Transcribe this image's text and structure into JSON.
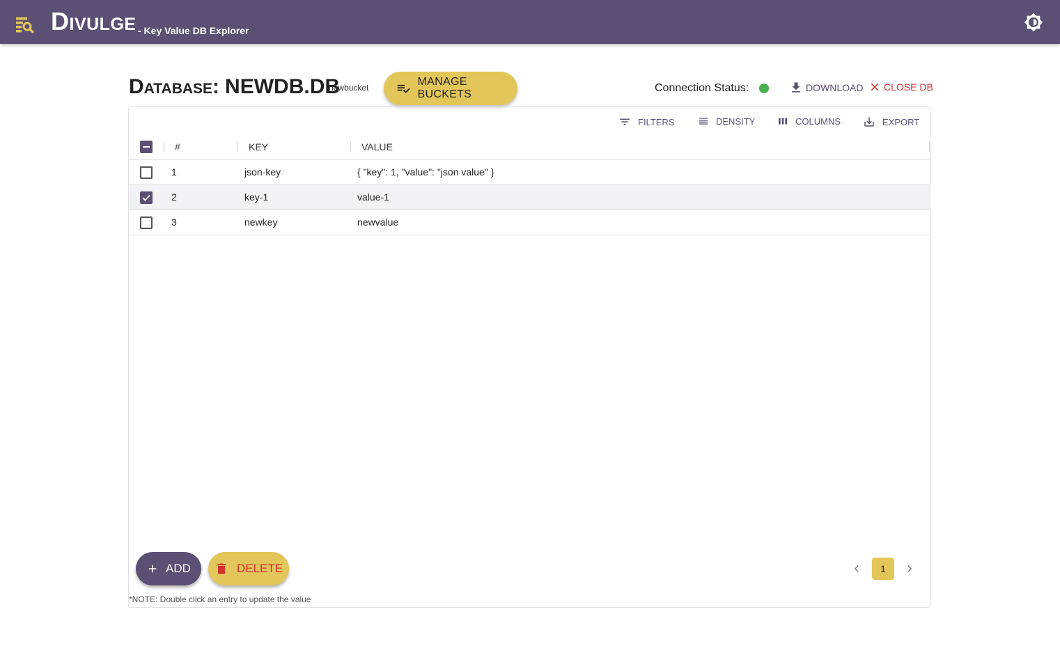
{
  "app": {
    "title": "Divulge",
    "subtitle": "- Key Value DB Explorer",
    "logo_icon": "db-search-icon",
    "theme_icon": "brightness-icon"
  },
  "database": {
    "label": "Database:",
    "name": "NEWDB.DB",
    "bucket": "newbucket"
  },
  "actions": {
    "manage_buckets": "MANAGE BUCKETS",
    "connection_status_label": "Connection Status:",
    "connection_status_color": "#4caf50",
    "download": "DOWNLOAD",
    "close_db": "CLOSE DB"
  },
  "toolbar": {
    "filters": "FILTERS",
    "density": "DENSITY",
    "columns": "COLUMNS",
    "export": "EXPORT"
  },
  "table": {
    "columns": [
      "#",
      "KEY",
      "VALUE"
    ],
    "rows": [
      {
        "num": "1",
        "key": "json-key",
        "value": "{ \"key\": 1, \"value\": \"json value\" }",
        "selected": false
      },
      {
        "num": "2",
        "key": "key-1",
        "value": "value-1",
        "selected": true
      },
      {
        "num": "3",
        "key": "newkey",
        "value": "newvalue",
        "selected": false
      }
    ]
  },
  "footer": {
    "add": "ADD",
    "delete": "DELETE",
    "note": "*NOTE: Double click an entry to update the value",
    "current_page": "1"
  },
  "colors": {
    "primary": "#5b5073",
    "accent": "#e3c65a",
    "danger": "#d32f2f"
  }
}
